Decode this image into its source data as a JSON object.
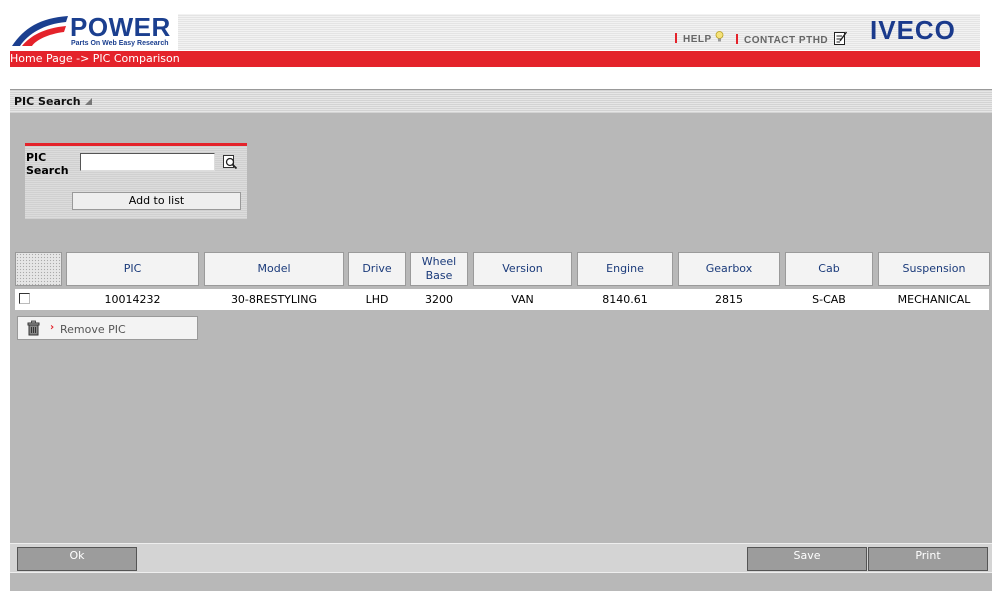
{
  "header": {
    "logo_title": "POWER",
    "logo_subtitle": "Parts On Web Easy Research",
    "help_label": "HELP",
    "contact_label": "CONTACT PTHD",
    "brand": "IVECO",
    "breadcrumb": "Home Page -> PIC Comparison"
  },
  "section": {
    "title": "PIC Search"
  },
  "search": {
    "label_line1": "PIC",
    "label_line2": "Search",
    "value": "",
    "add_label": "Add to list"
  },
  "table": {
    "headers": {
      "pic": "PIC",
      "model": "Model",
      "drive": "Drive",
      "wheelbase_line1": "Wheel",
      "wheelbase_line2": "Base",
      "version": "Version",
      "engine": "Engine",
      "gearbox": "Gearbox",
      "cab": "Cab",
      "suspension": "Suspension"
    },
    "rows": [
      {
        "pic": "10014232",
        "model": "30-8RESTYLING",
        "drive": "LHD",
        "wheelbase": "3200",
        "version": "VAN",
        "engine": "8140.61",
        "gearbox": "2815",
        "cab": "S-CAB",
        "suspension": "MECHANICAL"
      }
    ]
  },
  "actions": {
    "remove_label": "Remove PIC",
    "ok_label": "Ok",
    "save_label": "Save",
    "print_label": "Print"
  },
  "colors": {
    "accent_red": "#e4232b",
    "brand_blue": "#1b3f8f",
    "panel_gray": "#b8b8b8"
  }
}
